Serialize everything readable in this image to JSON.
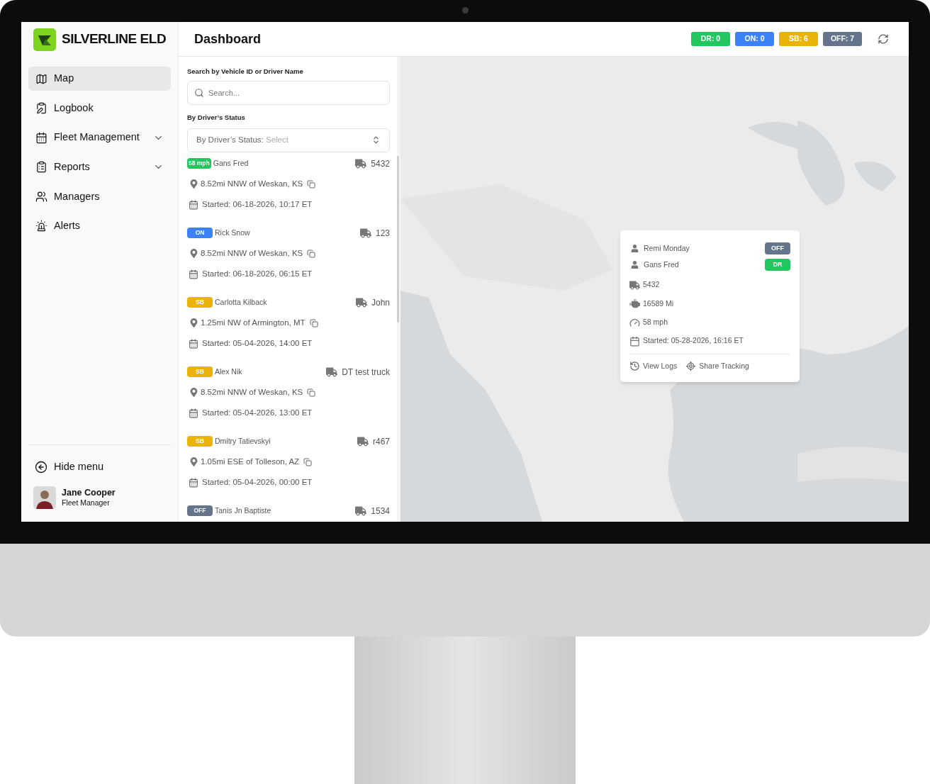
{
  "sidebar": {
    "brand": "SILVERLINE ELD",
    "items": [
      {
        "label": "Map",
        "selected": true
      },
      {
        "label": "Logbook",
        "selected": false
      },
      {
        "label": "Fleet Management",
        "selected": false,
        "expanded": false
      },
      {
        "label": "Reports",
        "selected": false,
        "expanded": false
      },
      {
        "label": "Managers",
        "selected": false
      },
      {
        "label": "Alerts",
        "selected": false
      }
    ],
    "hide_menu": "Hide menu",
    "user": {
      "name": "Jane Cooper",
      "role": "Fleet Manager"
    }
  },
  "header": {
    "title": "Dashboard",
    "status_counts": [
      {
        "label": "DR: 0",
        "kind": "dr"
      },
      {
        "label": "ON: 0",
        "kind": "on"
      },
      {
        "label": "SB: 6",
        "kind": "sb"
      },
      {
        "label": "OFF: 7",
        "kind": "off"
      }
    ]
  },
  "filters": {
    "search_label": "Search by Vehicle ID or Driver Name",
    "search_placeholder": "Search...",
    "status_label": "By Driver’s Status",
    "status_select_prefix": "By Driver’s Status:",
    "status_select_placeholder": "Select"
  },
  "drivers": [
    {
      "badge": {
        "label": "58 mph",
        "kind": "dr"
      },
      "name": "Gans Fred",
      "vehicle": "5432",
      "location": "8.52mi NNW of Weskan, KS",
      "started": "Started: 06-18-2026, 10:17 ET"
    },
    {
      "badge": {
        "label": "ON",
        "kind": "on"
      },
      "name": "Rick Snow",
      "vehicle": "123",
      "location": "8.52mi NNW of Weskan, KS",
      "started": "Started: 06-18-2026, 06:15 ET"
    },
    {
      "badge": {
        "label": "SB",
        "kind": "sb"
      },
      "name": "Carlotta Kilback",
      "vehicle": "John",
      "location": "1.25mi NW of Armington, MT",
      "started": "Started: 05-04-2026, 14:00 ET"
    },
    {
      "badge": {
        "label": "SB",
        "kind": "sb"
      },
      "name": "Alex Nik",
      "vehicle": "DT test truck",
      "location": "8.52mi NNW of Weskan, KS",
      "started": "Started: 05-04-2026, 13:00 ET"
    },
    {
      "badge": {
        "label": "SB",
        "kind": "sb"
      },
      "name": "Dmitry Tatievskyi",
      "vehicle": "r467",
      "location": "1.05mi ESE of Tolleson, AZ",
      "started": "Started: 05-04-2026, 00:00 ET"
    },
    {
      "badge": {
        "label": "OFF",
        "kind": "off"
      },
      "name": "Tanis Jn Baptiste",
      "vehicle": "1534"
    }
  ],
  "map_popup": {
    "drivers": [
      {
        "name": "Remi Monday",
        "status": {
          "label": "OFF",
          "kind": "off"
        }
      },
      {
        "name": "Gans Fred",
        "status": {
          "label": "DR",
          "kind": "dr"
        }
      }
    ],
    "vehicle": "5432",
    "odometer": "16589 Mi",
    "speed": "58 mph",
    "started": "Started: 05-28-2026, 16:16 ET",
    "actions": [
      "View Logs",
      "Share Tracking"
    ]
  }
}
